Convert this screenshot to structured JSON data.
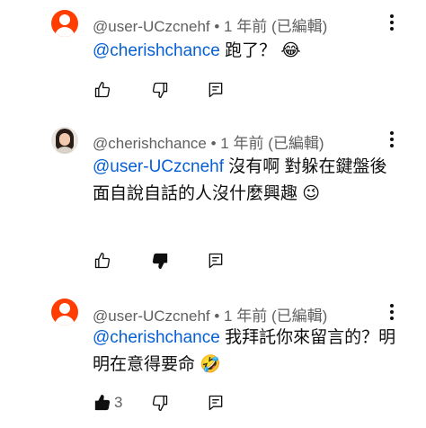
{
  "comments": [
    {
      "author": "@user-UCzcnehf",
      "separator": " • ",
      "time": "1 年前",
      "edited": "(已編輯)",
      "mention": "@cherishchance",
      "text": "  跑了？ 😂",
      "like_count": "",
      "disliked": false,
      "liked": false
    },
    {
      "author": "@cherishchance",
      "separator": " • ",
      "time": "1 年前",
      "edited": "(已編輯)",
      "mention": "@user-UCzcnehf",
      "text": "  沒有啊 對躲在鍵盤後面自說自話的人沒什麼興趣 😉",
      "like_count": "",
      "disliked": true,
      "liked": false
    },
    {
      "author": "@user-UCzcnehf",
      "separator": " • ",
      "time": "1 年前",
      "edited": "(已編輯)",
      "mention": "@cherishchance",
      "text": "  我拜託你來留言的？明明在意得要命 🤣",
      "like_count": "3",
      "disliked": false,
      "liked": true
    }
  ],
  "icons": {
    "like": "thumbs-up-icon",
    "dislike": "thumbs-down-icon",
    "reply": "reply-icon",
    "menu": "more-vert-icon"
  },
  "colors": {
    "mention": "#065fd4",
    "default_avatar": "#ff3d00",
    "meta": "#606060"
  }
}
